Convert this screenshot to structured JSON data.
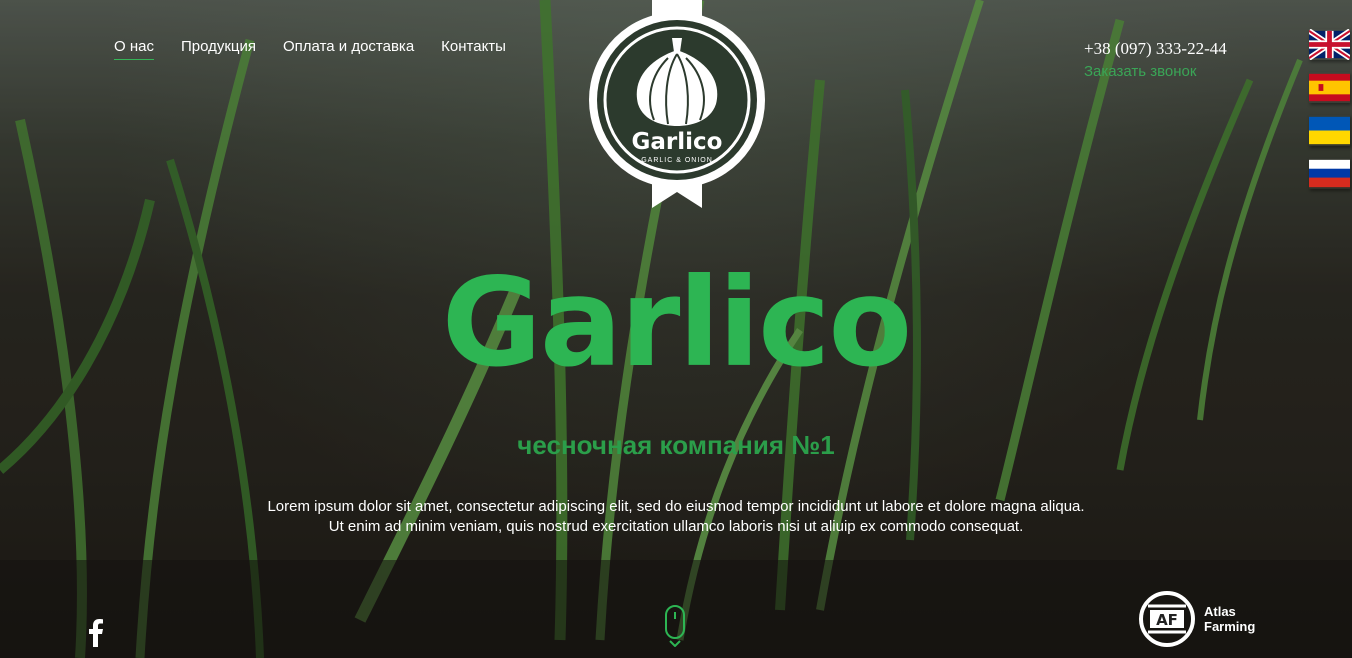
{
  "nav": {
    "items": [
      {
        "label": "О нас",
        "active": true
      },
      {
        "label": "Продукция",
        "active": false
      },
      {
        "label": "Оплата и доставка",
        "active": false
      },
      {
        "label": "Контакты",
        "active": false
      }
    ]
  },
  "logo": {
    "name": "Garlico",
    "sub": "GARLIC & ONION",
    "icon": "garlic-icon"
  },
  "contact": {
    "phone": "+38 (097) 333-22-44",
    "callback": "Заказать звонок"
  },
  "languages": [
    {
      "code": "en",
      "icon": "uk-flag-icon"
    },
    {
      "code": "es",
      "icon": "spain-flag-icon"
    },
    {
      "code": "ua",
      "icon": "ukraine-flag-icon"
    },
    {
      "code": "ru",
      "icon": "russia-flag-icon"
    }
  ],
  "hero": {
    "title": "Garlico",
    "tagline": "чесночная компания №1",
    "description_line1": "Lorem ipsum dolor sit amet, consectetur adipiscing elit, sed do eiusmod tempor incididunt ut labore et dolore magna aliqua.",
    "description_line2": "Ut enim ad minim veniam, quis nostrud exercitation ullamco laboris nisi ut aliuip ex commodo consequat."
  },
  "social": {
    "facebook_icon": "facebook-icon"
  },
  "scroll": {
    "icon": "mouse-scroll-icon"
  },
  "partner": {
    "logo_text": "AF",
    "name_line1": "Atlas",
    "name_line2": "Farming"
  },
  "colors": {
    "accent": "#2db553",
    "accent_dark": "#2b9e4a",
    "callback": "#3aa556"
  }
}
